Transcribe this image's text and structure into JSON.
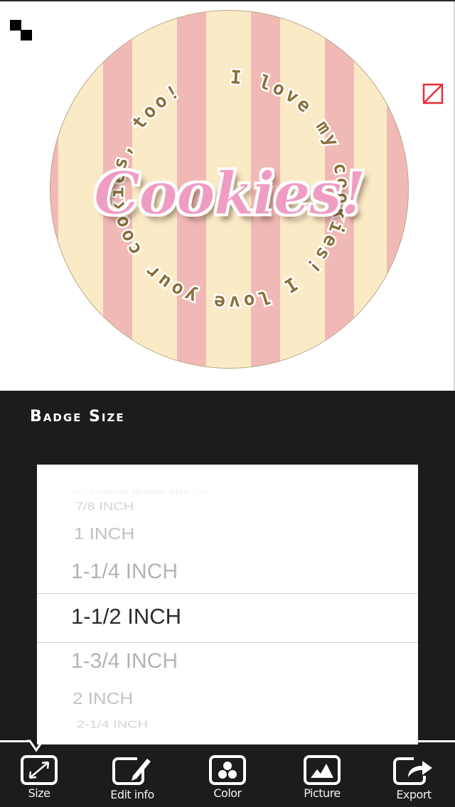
{
  "badge": {
    "title": "Cookies!",
    "circular_text": "I love my cookies! I love your cookies, too!",
    "colors": {
      "stripe_pink": "#f1b9b6",
      "stripe_cream": "#faeac6",
      "title_pink": "#ef9dc2",
      "circle_text": "#8a6f3a",
      "heart": "#8af6f2"
    }
  },
  "canvas": {
    "resize_handle_icon": "resize-handle-icon",
    "no_image_icon": "no-image-icon"
  },
  "panel": {
    "title": "Badge Size",
    "picker": {
      "items": [
        "---- Choose Button Size ----",
        "7/8 INCH",
        "1 INCH",
        "1-1/4 INCH",
        "1-1/2 INCH",
        "1-3/4 INCH",
        "2 INCH",
        "2-1/4 INCH"
      ],
      "selected": "1-1/2 INCH"
    }
  },
  "toolbar": {
    "items": [
      {
        "label": "Size",
        "icon": "resize-arrows-icon",
        "active": true
      },
      {
        "label": "Edit info",
        "icon": "edit-pencil-icon",
        "active": false
      },
      {
        "label": "Color",
        "icon": "color-dots-icon",
        "active": false
      },
      {
        "label": "Picture",
        "icon": "picture-mountain-icon",
        "active": false
      },
      {
        "label": "Export",
        "icon": "export-share-icon",
        "active": false
      }
    ]
  }
}
